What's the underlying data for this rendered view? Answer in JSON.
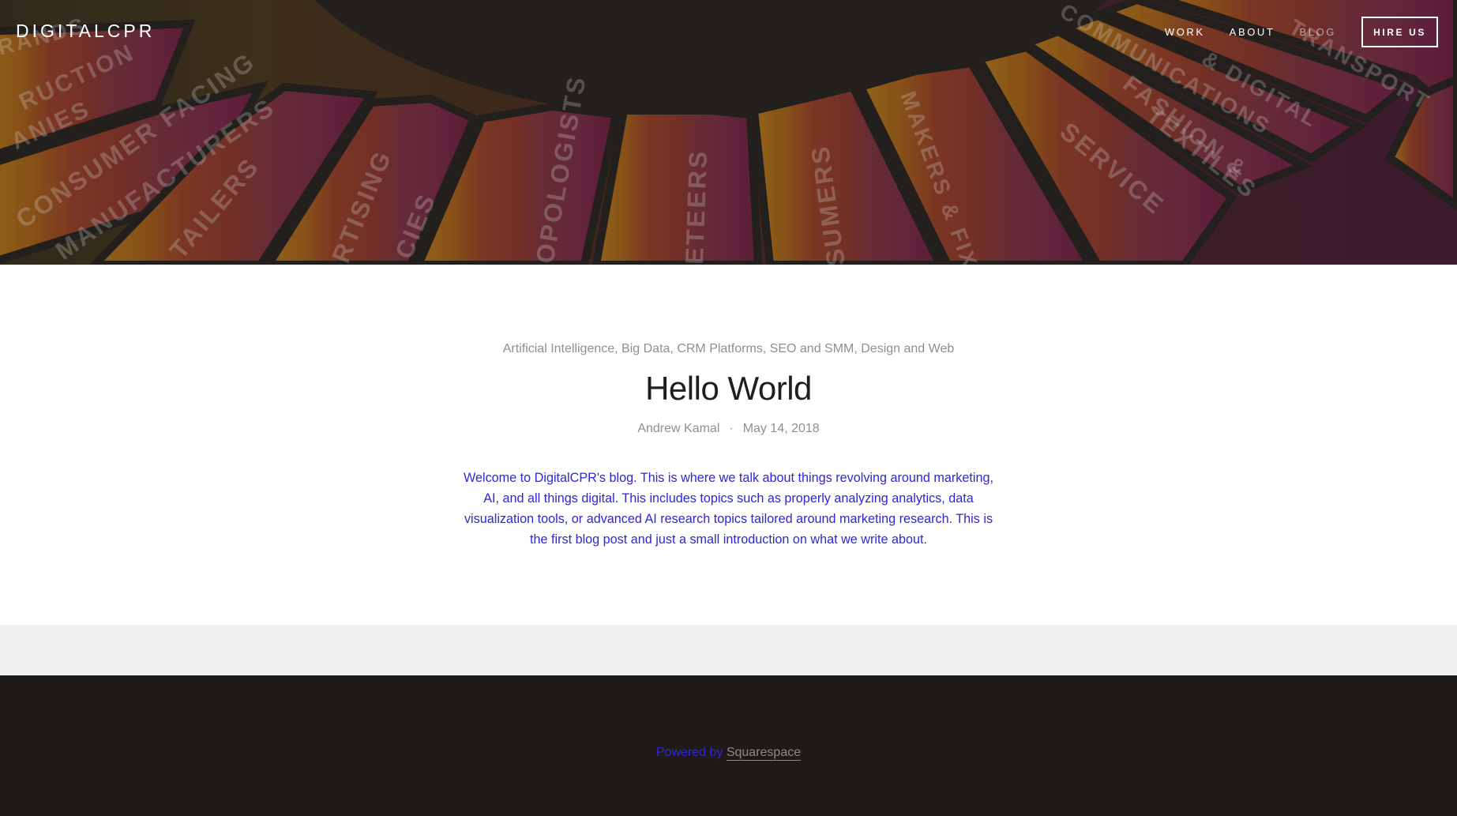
{
  "header": {
    "brand": "DIGITALCPR",
    "nav": [
      {
        "label": "WORK"
      },
      {
        "label": "ABOUT"
      },
      {
        "label": "BLOG"
      }
    ],
    "cta_label": "HIRE US"
  },
  "hero_image": {
    "segment_labels": [
      "RUCTION",
      "ANIES",
      "CONSUMER FACING",
      "MANUFACTURERS",
      "TAILERS",
      "RTISING",
      "CIES",
      "OPOLOGISTS",
      "ETEERS",
      "SUMERS",
      "MAKERS & FIXERS",
      "SERVICE",
      "FASHION &",
      "TEXTILES",
      "COMMUNICATIONS",
      "& DIGITAL",
      "TRANSPORT",
      "RANDS"
    ]
  },
  "post": {
    "categories": [
      "Artificial Intelligence",
      "Big Data",
      "CRM Platforms",
      "SEO and SMM",
      "Design and Web"
    ],
    "title": "Hello World",
    "author": "Andrew Kamal",
    "separator": "·",
    "date": "May 14, 2018",
    "body": "Welcome to DigitalCPR's blog. This is where we talk about things revolving around marketing, AI, and all things digital. This includes topics such as properly analyzing analytics, data visualization tools, or advanced AI research topics tailored around marketing research. This is the first blog post and just a small introduction on what we write about."
  },
  "footer": {
    "powered_lead": "Powered by",
    "powered_link": "Squarespace"
  },
  "colors": {
    "body_text": "#2d27d6",
    "muted": "#8f8f8f",
    "footer_bg": "#1e1a17",
    "strip_bg": "#efefef"
  }
}
